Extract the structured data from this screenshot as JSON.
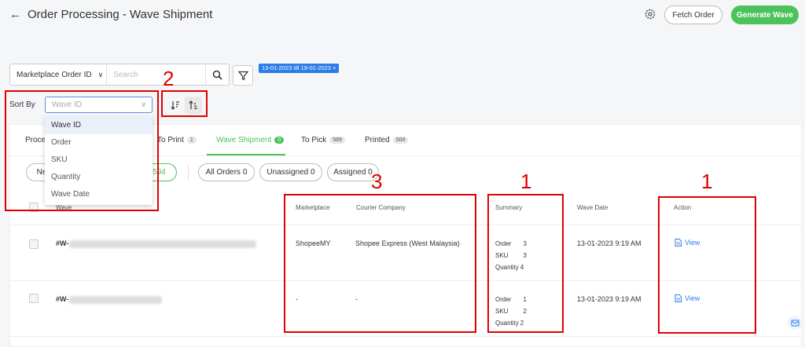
{
  "header": {
    "title": "Order Processing - Wave Shipment",
    "fetch_label": "Fetch Order",
    "generate_label": "Generate Wave"
  },
  "search": {
    "field_select": "Marketplace Order ID",
    "placeholder": "Search",
    "date_chip": "13-01-2023 till 19-01-2023 ×"
  },
  "sort": {
    "label": "Sort By",
    "placeholder": "Wave ID",
    "options": [
      "Wave ID",
      "Order",
      "SKU",
      "Quantity",
      "Wave Date"
    ]
  },
  "tabs": [
    {
      "label": "Proce",
      "count": ""
    },
    {
      "label": "To Print",
      "count": "1"
    },
    {
      "label": "Wave Shipment",
      "count": "0"
    },
    {
      "label": "To Pick",
      "count": "589"
    },
    {
      "label": "Printed",
      "count": "504"
    }
  ],
  "pills": {
    "new": "Ne",
    "green_count": "594",
    "all": "All Orders 0",
    "unassigned": "Unassigned 0",
    "assigned": "Assigned 0"
  },
  "table": {
    "headers": {
      "wave": "Wave",
      "marketplace": "Marketplace",
      "courier": "Courier Company",
      "summary": "Summary",
      "date": "Wave Date",
      "action": "Action"
    },
    "summary_labels": {
      "order": "Order",
      "sku": "SKU",
      "quantity": "Quantity"
    },
    "rows": [
      {
        "wave_prefix": "#W-",
        "marketplace": "ShopeeMY",
        "courier": "Shopee Express (West Malaysia)",
        "order": "3",
        "sku": "3",
        "quantity": "4",
        "date": "13-01-2023 9:19 AM",
        "action": "View"
      },
      {
        "wave_prefix": "#W-",
        "marketplace": "-",
        "courier": "-",
        "order": "1",
        "sku": "2",
        "quantity": "2",
        "date": "13-01-2023 9:19 AM",
        "action": "View"
      }
    ]
  },
  "annotations": {
    "label_2": "2",
    "label_3": "3",
    "label_1a": "1",
    "label_1b": "1"
  },
  "colors": {
    "accent_green": "#4cc35a",
    "link_blue": "#2b7de9",
    "annotation_red": "#e00000"
  }
}
